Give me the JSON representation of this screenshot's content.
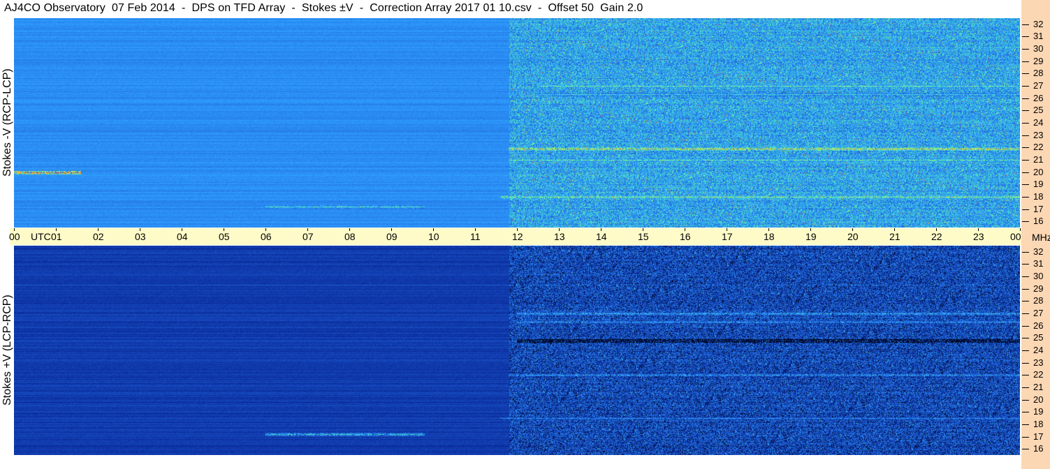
{
  "title": "AJ4CO Observatory  07 Feb 2014  -  DPS on TFD Array  -  Stokes ±V  -  Correction Array 2017 01 10.csv  -  Offset 50  Gain 2.0",
  "chart_data": {
    "type": "heatmap",
    "title": "AJ4CO Observatory  07 Feb 2014  -  DPS on TFD Array  -  Stokes ±V  -  Correction Array 2017 01 10.csv  -  Offset 50  Gain 2.0",
    "x_unit": "UTC",
    "y_unit": "MHz",
    "xlim": [
      0,
      24
    ],
    "ylim": [
      15.5,
      32.5
    ],
    "x_ticks": [
      "00",
      "01",
      "02",
      "03",
      "04",
      "05",
      "06",
      "07",
      "08",
      "09",
      "10",
      "11",
      "12",
      "13",
      "14",
      "15",
      "16",
      "17",
      "18",
      "19",
      "20",
      "21",
      "22",
      "23",
      "00"
    ],
    "y_ticks": [
      "32",
      "31",
      "30",
      "29",
      "28",
      "27",
      "26",
      "25",
      "24",
      "23",
      "22",
      "21",
      "20",
      "19",
      "18",
      "17",
      "16"
    ],
    "panels": [
      {
        "name": "Stokes -V (RCP-LCP)",
        "colormap": [
          "#000820",
          "#0a2a9a",
          "#1f63d8",
          "#2f9fff",
          "#4ee8c0",
          "#d8f040",
          "#ff2020"
        ],
        "background_level": 0.45,
        "bands": [
          {
            "freq": 21.9,
            "x_start": 11.8,
            "x_end": 24,
            "intensity": 0.85
          },
          {
            "freq": 21.0,
            "x_start": 11.8,
            "x_end": 24,
            "intensity": 0.7
          },
          {
            "freq": 20.0,
            "x_start": 0,
            "x_end": 1.6,
            "intensity": 0.95
          },
          {
            "freq": 18.0,
            "x_start": 11.6,
            "x_end": 24,
            "intensity": 0.75
          },
          {
            "freq": 27.0,
            "x_start": 12.5,
            "x_end": 24,
            "intensity": 0.7
          },
          {
            "freq": 26.3,
            "x_start": 12.5,
            "x_end": 24,
            "intensity": 0.6
          },
          {
            "freq": 17.2,
            "x_start": 6.0,
            "x_end": 9.8,
            "intensity": 0.65
          }
        ]
      },
      {
        "name": "Stokes +V (LCP-RCP)",
        "colormap": [
          "#000820",
          "#0a2a9a",
          "#1f63d8",
          "#2f9fff",
          "#4ee8c0",
          "#d8f040",
          "#ff2020"
        ],
        "background_level": 0.22,
        "bands": [
          {
            "freq": 27.0,
            "x_start": 12.0,
            "x_end": 24,
            "intensity": 0.55
          },
          {
            "freq": 26.3,
            "x_start": 12.0,
            "x_end": 24,
            "intensity": 0.5
          },
          {
            "freq": 24.8,
            "x_start": 12.0,
            "x_end": 24,
            "intensity": 0.05
          },
          {
            "freq": 22.0,
            "x_start": 11.8,
            "x_end": 24,
            "intensity": 0.5
          },
          {
            "freq": 17.2,
            "x_start": 6.0,
            "x_end": 9.8,
            "intensity": 0.6
          },
          {
            "freq": 18.5,
            "x_start": 11.6,
            "x_end": 24,
            "intensity": 0.45
          }
        ]
      }
    ]
  }
}
